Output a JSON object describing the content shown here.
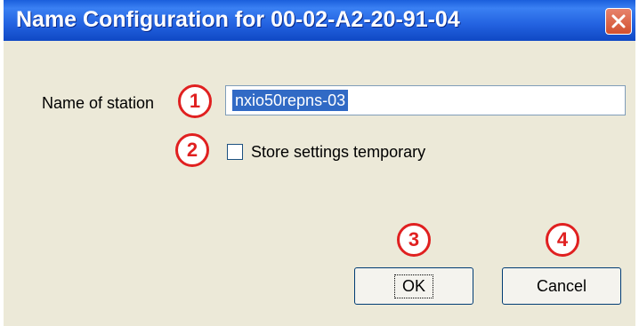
{
  "window": {
    "title": "Name Configuration for 00-02-A2-20-91-04",
    "close_icon": "close-icon"
  },
  "form": {
    "name_label": "Name of station",
    "name_value": "nxio50repns-03",
    "store_label": "Store settings temporary",
    "store_checked": false
  },
  "buttons": {
    "ok": "OK",
    "cancel": "Cancel"
  },
  "annotations": [
    "1",
    "2",
    "3",
    "4"
  ],
  "colors": {
    "titlebar": "#2362e0",
    "dialog_bg": "#ece9d8",
    "selection": "#316ac5",
    "annotation": "#e02020"
  }
}
